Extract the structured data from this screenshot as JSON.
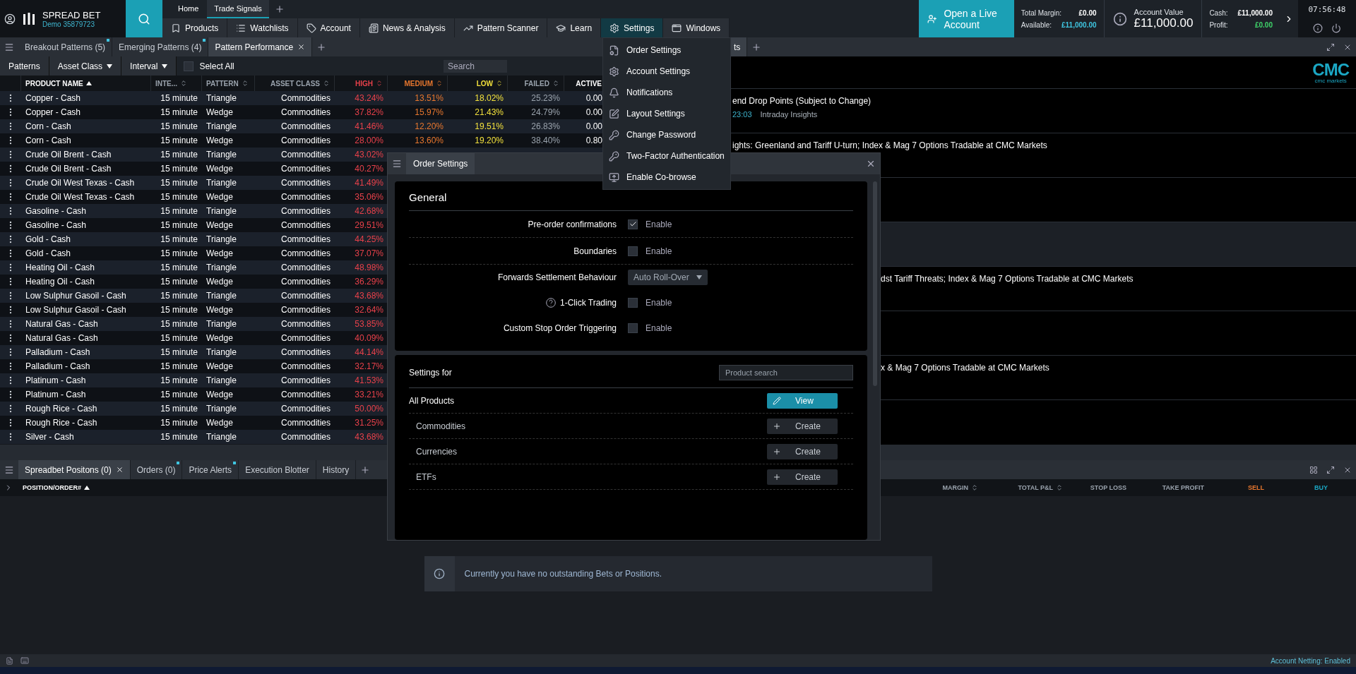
{
  "header": {
    "brand": "SPREAD BET",
    "account_id": "Demo 35879723",
    "top_tabs": [
      {
        "label": "Home",
        "selected": false
      },
      {
        "label": "Trade Signals",
        "selected": true
      }
    ],
    "nav": [
      {
        "label": "Products",
        "selected": false
      },
      {
        "label": "Watchlists",
        "selected": false
      },
      {
        "label": "Account",
        "selected": false
      },
      {
        "label": "News & Analysis",
        "selected": false
      },
      {
        "label": "Pattern Scanner",
        "selected": false
      },
      {
        "label": "Learn",
        "selected": false
      },
      {
        "label": "Settings",
        "selected": true
      },
      {
        "label": "Windows",
        "selected": false
      }
    ],
    "live_account_button": "Open a Live Account",
    "total_margin": {
      "label": "Total Margin:",
      "value": "£0.00"
    },
    "available": {
      "label": "Available:",
      "value": "£11,000.00"
    },
    "account_value": {
      "label": "Account Value",
      "value": "£11,000.00"
    },
    "cash": {
      "label": "Cash:",
      "value": "£11,000.00"
    },
    "profit": {
      "label": "Profit:",
      "value": "£0.00"
    },
    "clock": "07:56:48"
  },
  "settings_menu": {
    "items": [
      "Order Settings",
      "Account Settings",
      "Notifications",
      "Layout Settings",
      "Change Password",
      "Two-Factor Authentication",
      "Enable Co-browse"
    ]
  },
  "workspace_tabs": [
    {
      "label": "Breakout Patterns (5)",
      "selected": false,
      "dot": true
    },
    {
      "label": "Emerging Patterns (4)",
      "selected": false,
      "dot": true
    },
    {
      "label": "Pattern Performance",
      "selected": true,
      "dot": false
    }
  ],
  "news_tabs": [
    {
      "label": "ts",
      "selected": true
    }
  ],
  "toolbar": {
    "patterns": "Patterns",
    "asset_class": "Asset Class",
    "interval": "Interval",
    "select_all": {
      "label": "Select All",
      "checked": false
    },
    "search": {
      "placeholder": "Search"
    }
  },
  "table": {
    "columns": [
      {
        "label": "PRODUCT NAME",
        "sortable": true,
        "sorted": true,
        "color": "#ffffff"
      },
      {
        "label": "INTE...",
        "sortable": true,
        "sorted": false,
        "color": "#9aa3ad"
      },
      {
        "label": "PATTERN",
        "sortable": true,
        "sorted": false,
        "color": "#9aa3ad"
      },
      {
        "label": "ASSET CLASS",
        "sortable": true,
        "sorted": false,
        "color": "#9aa3ad"
      },
      {
        "label": "HIGH",
        "sortable": true,
        "sorted": false,
        "color": "#e8414a"
      },
      {
        "label": "MEDIUM",
        "sortable": true,
        "sorted": false,
        "color": "#e8772e"
      },
      {
        "label": "LOW",
        "sortable": true,
        "sorted": false,
        "color": "#f2e03c"
      },
      {
        "label": "FAILED",
        "sortable": true,
        "sorted": false,
        "color": "#9aa3ad"
      },
      {
        "label": "ACTIVE",
        "sortable": false,
        "color": "#ffffff"
      }
    ],
    "rows": [
      {
        "cells": [
          "Copper - Cash",
          "15 minute",
          "Triangle",
          "Commodities",
          "43.24%",
          "13.51%",
          "18.02%",
          "25.23%",
          "0.00"
        ]
      },
      {
        "cells": [
          "Copper - Cash",
          "15 minute",
          "Wedge",
          "Commodities",
          "37.82%",
          "15.97%",
          "21.43%",
          "24.79%",
          "0.00"
        ]
      },
      {
        "cells": [
          "Corn - Cash",
          "15 minute",
          "Triangle",
          "Commodities",
          "41.46%",
          "12.20%",
          "19.51%",
          "26.83%",
          "0.00"
        ]
      },
      {
        "cells": [
          "Corn - Cash",
          "15 minute",
          "Wedge",
          "Commodities",
          "28.00%",
          "13.60%",
          "19.20%",
          "38.40%",
          "0.80"
        ]
      },
      {
        "cells": [
          "Crude Oil Brent - Cash",
          "15 minute",
          "Triangle",
          "Commodities",
          "43.02%"
        ]
      },
      {
        "cells": [
          "Crude Oil Brent - Cash",
          "15 minute",
          "Wedge",
          "Commodities",
          "40.27%"
        ]
      },
      {
        "cells": [
          "Crude Oil West Texas - Cash",
          "15 minute",
          "Triangle",
          "Commodities",
          "41.49%"
        ]
      },
      {
        "cells": [
          "Crude Oil West Texas - Cash",
          "15 minute",
          "Wedge",
          "Commodities",
          "35.06%"
        ]
      },
      {
        "cells": [
          "Gasoline - Cash",
          "15 minute",
          "Triangle",
          "Commodities",
          "42.68%"
        ]
      },
      {
        "cells": [
          "Gasoline - Cash",
          "15 minute",
          "Wedge",
          "Commodities",
          "29.51%"
        ]
      },
      {
        "cells": [
          "Gold - Cash",
          "15 minute",
          "Triangle",
          "Commodities",
          "44.25%"
        ]
      },
      {
        "cells": [
          "Gold - Cash",
          "15 minute",
          "Wedge",
          "Commodities",
          "37.07%"
        ]
      },
      {
        "cells": [
          "Heating Oil - Cash",
          "15 minute",
          "Triangle",
          "Commodities",
          "48.98%"
        ]
      },
      {
        "cells": [
          "Heating Oil - Cash",
          "15 minute",
          "Wedge",
          "Commodities",
          "36.29%"
        ]
      },
      {
        "cells": [
          "Low Sulphur Gasoil - Cash",
          "15 minute",
          "Triangle",
          "Commodities",
          "43.68%"
        ]
      },
      {
        "cells": [
          "Low Sulphur Gasoil - Cash",
          "15 minute",
          "Wedge",
          "Commodities",
          "32.64%"
        ]
      },
      {
        "cells": [
          "Natural Gas - Cash",
          "15 minute",
          "Triangle",
          "Commodities",
          "53.85%"
        ]
      },
      {
        "cells": [
          "Natural Gas - Cash",
          "15 minute",
          "Wedge",
          "Commodities",
          "40.09%"
        ]
      },
      {
        "cells": [
          "Palladium - Cash",
          "15 minute",
          "Triangle",
          "Commodities",
          "44.14%"
        ]
      },
      {
        "cells": [
          "Palladium - Cash",
          "15 minute",
          "Wedge",
          "Commodities",
          "32.17%"
        ]
      },
      {
        "cells": [
          "Platinum - Cash",
          "15 minute",
          "Triangle",
          "Commodities",
          "41.53%"
        ]
      },
      {
        "cells": [
          "Platinum - Cash",
          "15 minute",
          "Wedge",
          "Commodities",
          "33.21%"
        ]
      },
      {
        "cells": [
          "Rough Rice - Cash",
          "15 minute",
          "Triangle",
          "Commodities",
          "50.00%"
        ]
      },
      {
        "cells": [
          "Rough Rice - Cash",
          "15 minute",
          "Wedge",
          "Commodities",
          "31.25%"
        ]
      },
      {
        "cells": [
          "Silver - Cash",
          "15 minute",
          "Triangle",
          "Commodities",
          "43.68%"
        ]
      }
    ]
  },
  "news": {
    "logo": "CMC",
    "logo_caption": "cmc markets",
    "items": [
      {
        "title": "end Drop Points (Subject to Change)",
        "time": "23:03",
        "source": "Intraday Insights",
        "highlighted": false
      },
      {
        "title": "ights: Greenland and Tariff U-turn; Index & Mag 7 Options Tradable at CMC Markets",
        "highlighted": false
      },
      {
        "highlighted": false
      },
      {
        "highlighted": true
      },
      {
        "title": "dst Tariff Threats; Index & Mag 7 Options Tradable at CMC Markets",
        "highlighted": false
      },
      {
        "highlighted": false
      },
      {
        "title": "x & Mag 7 Options Tradable at CMC Markets",
        "highlighted": false
      }
    ]
  },
  "order_settings": {
    "title": "Order Settings",
    "general": {
      "heading": "General",
      "settings": [
        {
          "kind": "checkbox",
          "label": "Pre-order confirmations",
          "option": "Enable",
          "checked": true,
          "help": false
        },
        {
          "kind": "checkbox",
          "label": "Boundaries",
          "option": "Enable",
          "checked": false,
          "help": false
        },
        {
          "kind": "select",
          "label": "Forwards Settlement Behaviour",
          "value": "Auto Roll-Over"
        },
        {
          "kind": "checkbox",
          "label": "1-Click Trading",
          "option": "Enable",
          "checked": false,
          "help": true
        },
        {
          "kind": "checkbox",
          "label": "Custom Stop Order Triggering",
          "option": "Enable",
          "checked": false,
          "help": false
        }
      ]
    },
    "settings_for": {
      "heading": "Settings for",
      "search": {
        "placeholder": "Product search"
      },
      "items": [
        {
          "label": "All Products",
          "button": "View",
          "primary": true
        },
        {
          "label": "Commodities",
          "button": "Create",
          "primary": false
        },
        {
          "label": "Currencies",
          "button": "Create",
          "primary": false
        },
        {
          "label": "ETFs",
          "button": "Create",
          "primary": false
        }
      ]
    }
  },
  "bottom_tabs": [
    {
      "label": "Spreadbet Positons (0)",
      "selected": true,
      "dot": false
    },
    {
      "label": "Orders (0)",
      "selected": false,
      "dot": true
    },
    {
      "label": "Price Alerts",
      "selected": false,
      "dot": true
    },
    {
      "label": "Execution Blotter",
      "selected": false,
      "dot": false
    },
    {
      "label": "History",
      "selected": false,
      "dot": false
    }
  ],
  "positions": {
    "first_column": {
      "label": "POSITION/ORDER#",
      "sortable": true,
      "sorted": true
    },
    "columns": [
      {
        "label": "MARGIN",
        "sortable": true,
        "sorted": false,
        "color": "#9aa3ad"
      },
      {
        "label": "TOTAL P&L",
        "sortable": true,
        "sorted": false,
        "color": "#9aa3ad"
      },
      {
        "label": "STOP LOSS",
        "sortable": false,
        "color": "#9aa3ad"
      },
      {
        "label": "TAKE PROFIT",
        "sortable": false,
        "color": "#9aa3ad"
      },
      {
        "label": "SELL",
        "sortable": false,
        "color": "#e8772e"
      },
      {
        "label": "BUY",
        "sortable": false,
        "color": "#1ba7c4"
      }
    ],
    "empty_message": "Currently you have no outstanding Bets or Positions."
  },
  "status_bar": {
    "text": "Account Netting: Enabled"
  }
}
